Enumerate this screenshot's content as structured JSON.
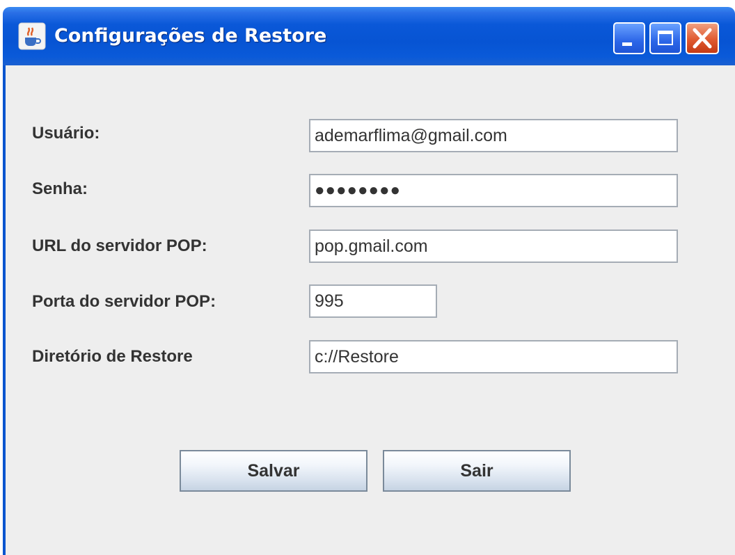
{
  "window": {
    "title": "Configurações de Restore",
    "icon": "java-cup-icon",
    "controls": [
      "minimize",
      "maximize",
      "close"
    ]
  },
  "form": {
    "fields": [
      {
        "label": "Usuário:",
        "value": "ademarflima@gmail.com"
      },
      {
        "label": "Senha:",
        "value": "●●●●●●●●"
      },
      {
        "label": "URL do servidor POP:",
        "value": "pop.gmail.com"
      },
      {
        "label": "Porta do servidor POP:",
        "value": "995"
      },
      {
        "label": "Diretório de Restore",
        "value": "c://Restore"
      }
    ]
  },
  "buttons": {
    "save_label": "Salvar",
    "exit_label": "Sair"
  }
}
